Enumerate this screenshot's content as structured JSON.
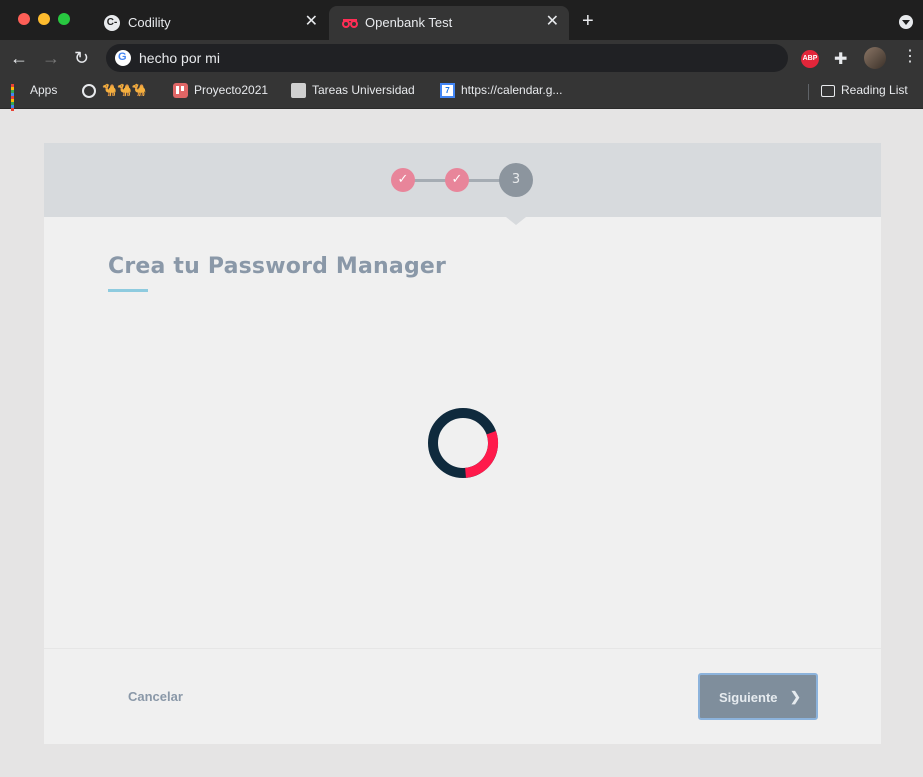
{
  "browser": {
    "tabs": [
      {
        "title": "Codility",
        "favicon": "codility-icon",
        "active": false
      },
      {
        "title": "Openbank Test",
        "favicon": "openbank-icon",
        "active": true
      }
    ],
    "new_tab_icon": "+",
    "address": "hecho por mi",
    "extensions": {
      "abp_label": "ABP"
    },
    "bookmarks": [
      {
        "label": "Apps",
        "icon": "apps-grid-icon"
      },
      {
        "label": "🐪🐪🐪",
        "icon": "globe-icon"
      },
      {
        "label": "Proyecto2021",
        "icon": "trello-icon"
      },
      {
        "label": "Tareas Universidad",
        "icon": "document-icon"
      },
      {
        "label": "https://calendar.g...",
        "icon": "calendar-icon",
        "badge": "7"
      }
    ],
    "reading_list": "Reading List"
  },
  "wizard": {
    "steps": [
      {
        "label": "✓",
        "state": "done"
      },
      {
        "label": "✓",
        "state": "done"
      },
      {
        "label": "3",
        "state": "current"
      }
    ],
    "title": "Crea tu Password Manager",
    "cancel_label": "Cancelar",
    "next_label": "Siguiente",
    "next_chevron": "❯",
    "colors": {
      "step_done": "#e8859a",
      "step_current": "#8c959e",
      "spinner_main": "#0f2a3d",
      "spinner_accent": "#ff1a4b",
      "accent_underline": "#8ecbdf"
    }
  }
}
